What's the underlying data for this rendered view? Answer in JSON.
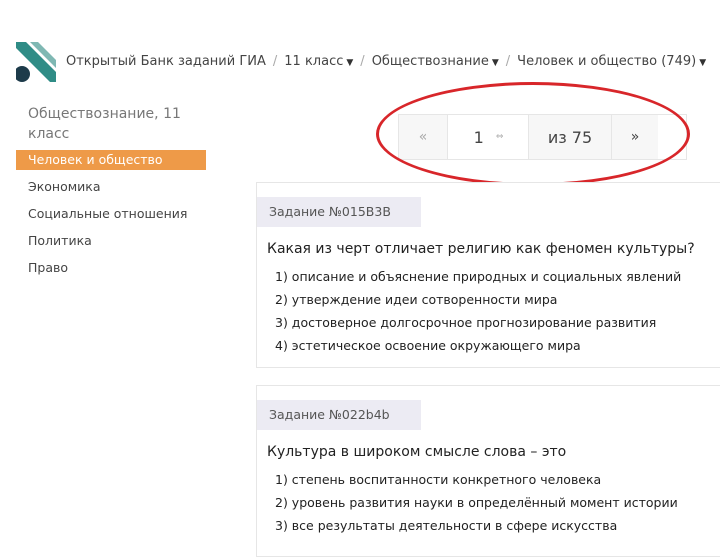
{
  "header": {
    "breadcrumb": [
      {
        "label": "Открытый Банк заданий ГИА",
        "dropdown": false
      },
      {
        "label": "11 класс",
        "dropdown": true
      },
      {
        "label": "Обществознание",
        "dropdown": true
      },
      {
        "label": "Человек и общество (749)",
        "dropdown": true
      }
    ],
    "separator": "/",
    "caret": "▼"
  },
  "sidebar": {
    "subject": "Обществознание, 11 класс",
    "items": [
      {
        "label": "Человек и общество",
        "active": true
      },
      {
        "label": "Экономика",
        "active": false
      },
      {
        "label": "Социальные отношения",
        "active": false
      },
      {
        "label": "Политика",
        "active": false
      },
      {
        "label": "Право",
        "active": false
      }
    ]
  },
  "pagination": {
    "prev": "«",
    "current": "1",
    "spinner": "⇔",
    "of_label": "из 75",
    "next": "»"
  },
  "tasks": [
    {
      "id_label": "Задание №015B3B",
      "question": "Какая из черт отличает религию как феномен культуры?",
      "answers": [
        "1) описание и объяснение природных и социальных явлений",
        "2) утверждение идеи сотворенности мира",
        "3) достоверное долгосрочное прогнозирование развития",
        "4) эстетическое освоение окружающего мира"
      ]
    },
    {
      "id_label": "Задание №022b4b",
      "question": "Культура в широком смысле слова – это",
      "answers": [
        "1) степень воспитанности конкретного человека",
        "2) уровень развития науки в определённый момент истории",
        "3) все результаты деятельности в сфере искусства"
      ]
    }
  ],
  "colors": {
    "accent": "#ee9a48",
    "highlight": "#d8262a",
    "task_label_bg": "#ecebf3",
    "logo_teal": "#2f8c86",
    "logo_dark": "#1d3b4a"
  }
}
